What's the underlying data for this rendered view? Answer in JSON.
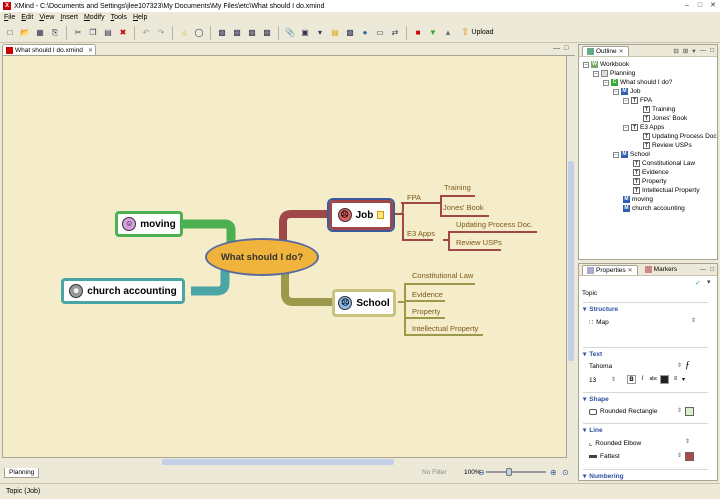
{
  "window": {
    "title": "XMind - C:\\Documents and Settings\\jlee107323\\My Documents\\My Files\\etc\\What should I do.xmind"
  },
  "menu": [
    "File",
    "Edit",
    "View",
    "Insert",
    "Modify",
    "Tools",
    "Help"
  ],
  "toolbar": {
    "upload_label": "Upload"
  },
  "editor": {
    "tab_label": "What should I do.xmind"
  },
  "map": {
    "central": "What should I do?",
    "left_topics": [
      "moving",
      "church accounting"
    ],
    "job": {
      "label": "Job",
      "fpa": "FPA",
      "fpa_children": [
        "Training",
        "Jones' Book"
      ],
      "e3": "E3 Apps",
      "e3_children": [
        "Updating Process Doc.",
        "Review USPs"
      ]
    },
    "school": {
      "label": "School",
      "children": [
        "Constitutional Law",
        "Evidence",
        "Property",
        "Intellectual Property"
      ]
    },
    "colors": {
      "central_fill": "#f0b33c",
      "central_border": "#5a6aa0",
      "job_branch": "#a04848",
      "school_branch": "#9c9a4a",
      "moving_branch": "#4caf50",
      "church_branch": "#4aa5a5"
    }
  },
  "sheetbar": {
    "sheet": "Planning",
    "filter": "No Filter",
    "zoom": "100%"
  },
  "status": {
    "text": "Topic (Job)"
  },
  "outline": {
    "title": "Outline",
    "rows": [
      {
        "label": "Workbook",
        "icon": "W",
        "kind": "wb"
      },
      {
        "label": "Planning",
        "icon": "",
        "kind": "sh"
      },
      {
        "label": "What should I do?",
        "icon": "C",
        "kind": "c"
      },
      {
        "label": "Job",
        "icon": "M",
        "kind": "m"
      },
      {
        "label": "FPA",
        "icon": "T",
        "kind": "t"
      },
      {
        "label": "Training",
        "icon": "T",
        "kind": "t"
      },
      {
        "label": "Jones' Book",
        "icon": "T",
        "kind": "t"
      },
      {
        "label": "E3 Apps",
        "icon": "T",
        "kind": "t"
      },
      {
        "label": "Updating Process Doc",
        "icon": "T",
        "kind": "t"
      },
      {
        "label": "Review USPs",
        "icon": "T",
        "kind": "t"
      },
      {
        "label": "School",
        "icon": "M",
        "kind": "m"
      },
      {
        "label": "Constitutional Law",
        "icon": "T",
        "kind": "t"
      },
      {
        "label": "Evidence",
        "icon": "T",
        "kind": "t"
      },
      {
        "label": "Property",
        "icon": "T",
        "kind": "t"
      },
      {
        "label": "Intellectual Property",
        "icon": "T",
        "kind": "t"
      },
      {
        "label": "moving",
        "icon": "M",
        "kind": "m"
      },
      {
        "label": "church accounting",
        "icon": "M",
        "kind": "m"
      }
    ]
  },
  "properties": {
    "tab": "Properties",
    "tab2": "Markers",
    "context": "Topic",
    "structure_title": "Structure",
    "structure_value": "Map",
    "text_title": "Text",
    "font": "Tahoma",
    "size": "13",
    "shape_title": "Shape",
    "shape_value": "Rounded Rectangle",
    "shape_color": "#d8f0c8",
    "line_title": "Line",
    "line_value": "Rounded Elbow",
    "line_width": "Fattest",
    "line_color": "#b04848",
    "numbering_title": "Numbering"
  }
}
